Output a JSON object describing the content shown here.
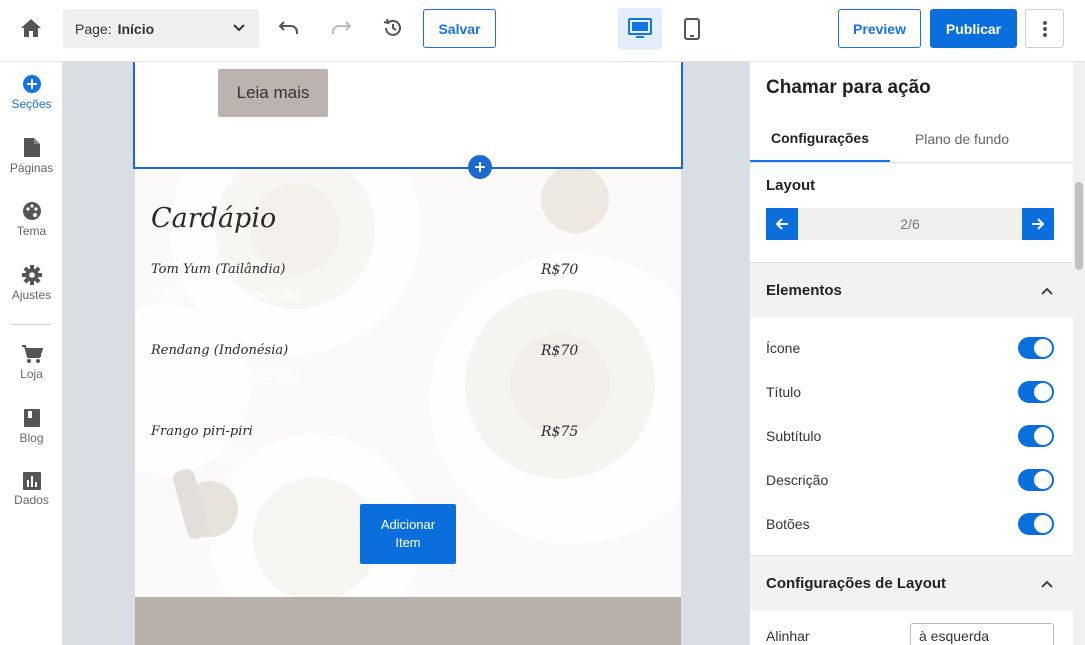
{
  "topbar": {
    "page_label": "Page:",
    "page_value": "Início",
    "save_label": "Salvar",
    "preview_label": "Preview",
    "publish_label": "Publicar"
  },
  "colors": {
    "accent": "#1473e6",
    "primary": "#0a6fdc",
    "brown": "#bcb3ae"
  },
  "nav": {
    "items": [
      {
        "label": "Seções",
        "icon": "plus-circle-icon",
        "active": true
      },
      {
        "label": "Páginas",
        "icon": "file-icon"
      },
      {
        "label": "Tema",
        "icon": "palette-icon"
      },
      {
        "label": "Ajustes",
        "icon": "gear-icon"
      },
      {
        "label": "Loja",
        "icon": "cart-icon"
      },
      {
        "label": "Blog",
        "icon": "book-icon"
      },
      {
        "label": "Dados",
        "icon": "chart-icon"
      }
    ]
  },
  "preview": {
    "cta_button": "Leia mais",
    "menu_title": "Cardápio",
    "menu_items": [
      {
        "name": "Tom Yum (Tailândia)",
        "price": "R$70",
        "desc": "Adicione uma descrição"
      },
      {
        "name": "Rendang (Indonésia)",
        "price": "R$70",
        "desc": "Adicione uma descrição"
      },
      {
        "name": "Frango piri-piri",
        "price": "R$75",
        "desc": "Adicione uma descrição"
      }
    ],
    "add_item_line1": "Adicionar",
    "add_item_line2": "Item"
  },
  "panel": {
    "title": "Chamar para ação",
    "tabs": [
      "Configurações",
      "Plano de fundo"
    ],
    "layout_label": "Layout",
    "layout_pager": "2/6",
    "elements_heading": "Elementos",
    "elements": [
      {
        "label": "Ícone",
        "on": true
      },
      {
        "label": "Título",
        "on": true
      },
      {
        "label": "Subtítulo",
        "on": true
      },
      {
        "label": "Descrição",
        "on": true
      },
      {
        "label": "Botões",
        "on": true
      }
    ],
    "layout_settings_heading": "Configurações de Layout",
    "align_label": "Alinhar",
    "align_value": "à esquerda"
  }
}
